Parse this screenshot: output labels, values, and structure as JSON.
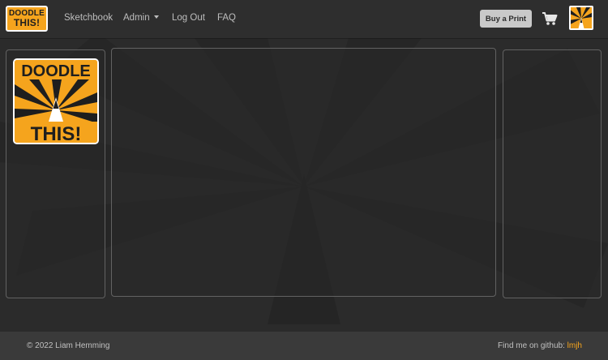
{
  "brand": {
    "line1": "DOODLE",
    "line2": "THIS!"
  },
  "nav": {
    "links": [
      {
        "label": "Sketchbook"
      },
      {
        "label": "Admin"
      },
      {
        "label": "Log Out"
      },
      {
        "label": "FAQ"
      }
    ],
    "buy_label": "Buy a Print",
    "cart_icon": "shopping-cart-icon"
  },
  "sidebar_logo": {
    "line1": "DOODLE",
    "line2": "THIS!"
  },
  "footer": {
    "copyright": "© 2022 Liam Hemming",
    "github_prefix": "Find me on github:",
    "github_handle": "lmjh"
  },
  "colors": {
    "accent": "#f5a41d",
    "background": "#2b2b2b",
    "navbar": "#2e2e2e",
    "footer": "#3a3a3a",
    "panel_border": "#626262"
  }
}
